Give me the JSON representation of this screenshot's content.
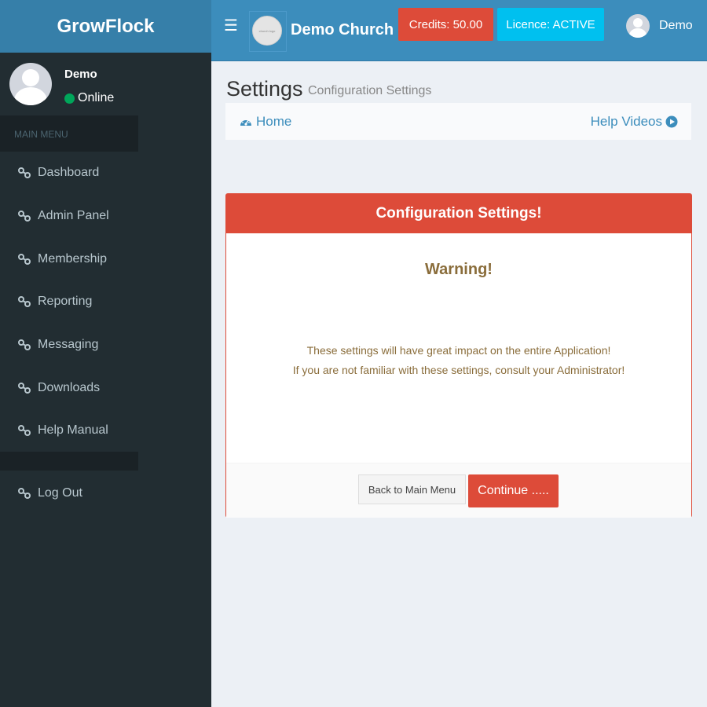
{
  "app": {
    "brand": "GrowFlock"
  },
  "header": {
    "church_name": "Demo Church",
    "church_logo_text": "church logo",
    "credits_label": "Credits: 50.00",
    "licence_label": "Licence: ACTIVE",
    "user_name": "Demo"
  },
  "sidebar": {
    "user_name": "Demo",
    "user_status": "Online",
    "menu_header": "MAIN MENU",
    "items": [
      {
        "label": "Dashboard"
      },
      {
        "label": "Admin Panel"
      },
      {
        "label": "Membership"
      },
      {
        "label": "Reporting"
      },
      {
        "label": "Messaging"
      },
      {
        "label": "Downloads"
      },
      {
        "label": "Help Manual"
      }
    ],
    "logout_label": "Log Out"
  },
  "content": {
    "title": "Settings",
    "subtitle": "Configuration Settings",
    "breadcrumb_home": "Home",
    "help_videos": "Help Videos"
  },
  "box": {
    "title": "Configuration Settings!",
    "warning_title": "Warning!",
    "line1": "These settings will have great impact on the entire Application!",
    "line2": "If you are not familiar with these settings, consult your Administrator!",
    "back_label": "Back to Main Menu",
    "continue_label": "Continue ....."
  },
  "colors": {
    "primary": "#3c8dbc",
    "brand_dark": "#367fa9",
    "danger": "#dd4b39",
    "info": "#00c0ef",
    "sidebar": "#222d32",
    "success": "#00a65a",
    "warning_text": "#8a6d3b"
  }
}
